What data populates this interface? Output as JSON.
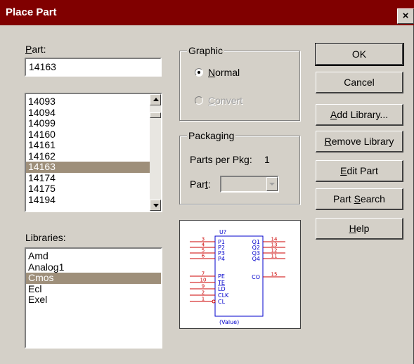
{
  "window": {
    "title": "Place Part",
    "close_glyph": "×"
  },
  "part_field": {
    "label_ul": "P",
    "label_rest": "art:",
    "value": "14163"
  },
  "parts_list": {
    "items": [
      "14093",
      "14094",
      "14099",
      "14160",
      "14161",
      "14162",
      "14163",
      "14174",
      "14175",
      "14194"
    ],
    "selected": "14163"
  },
  "libraries": {
    "label": "Libraries:",
    "items": [
      "Amd",
      "Analog1",
      "Cmos",
      "Ecl",
      "Exel"
    ],
    "selected": "Cmos"
  },
  "graphic": {
    "legend": "Graphic",
    "normal_ul": "N",
    "normal_rest": "ormal",
    "convert_ul": "C",
    "convert_rest": "onvert",
    "selected": "Normal"
  },
  "packaging": {
    "legend": "Packaging",
    "parts_per_pkg_label": "Parts per Pkg:",
    "parts_per_pkg_value": "1",
    "part_label_pre": "Par",
    "part_label_ul": "t",
    "part_label_post": ":"
  },
  "buttons": {
    "ok": "OK",
    "cancel": "Cancel",
    "add_library_ul": "A",
    "add_library_rest": "dd Library...",
    "remove_library_ul": "R",
    "remove_library_rest": "emove Library",
    "edit_part_ul": "E",
    "edit_part_rest": "dit Part",
    "part_search_pre": "Part ",
    "part_search_ul": "S",
    "part_search_rest": "earch",
    "help_ul": "H",
    "help_rest": "elp"
  },
  "preview": {
    "ref": "U?",
    "value": "(Value)",
    "left_pins": [
      {
        "num": "3",
        "name": "P1"
      },
      {
        "num": "4",
        "name": "P2"
      },
      {
        "num": "5",
        "name": "P3"
      },
      {
        "num": "6",
        "name": "P4"
      },
      {
        "num": "7",
        "name": "PE"
      },
      {
        "num": "10",
        "name": "TE"
      },
      {
        "num": "9",
        "name": "LD"
      },
      {
        "num": "2",
        "name": "CLK"
      },
      {
        "num": "1",
        "name": "CL"
      }
    ],
    "right_pins": [
      {
        "num": "14",
        "name": "Q1"
      },
      {
        "num": "13",
        "name": "Q2"
      },
      {
        "num": "12",
        "name": "Q3"
      },
      {
        "num": "11",
        "name": "Q4"
      },
      {
        "num": "15",
        "name": "CO"
      }
    ],
    "colors": {
      "pin": "#cc0000",
      "body": "#0000cc"
    }
  }
}
